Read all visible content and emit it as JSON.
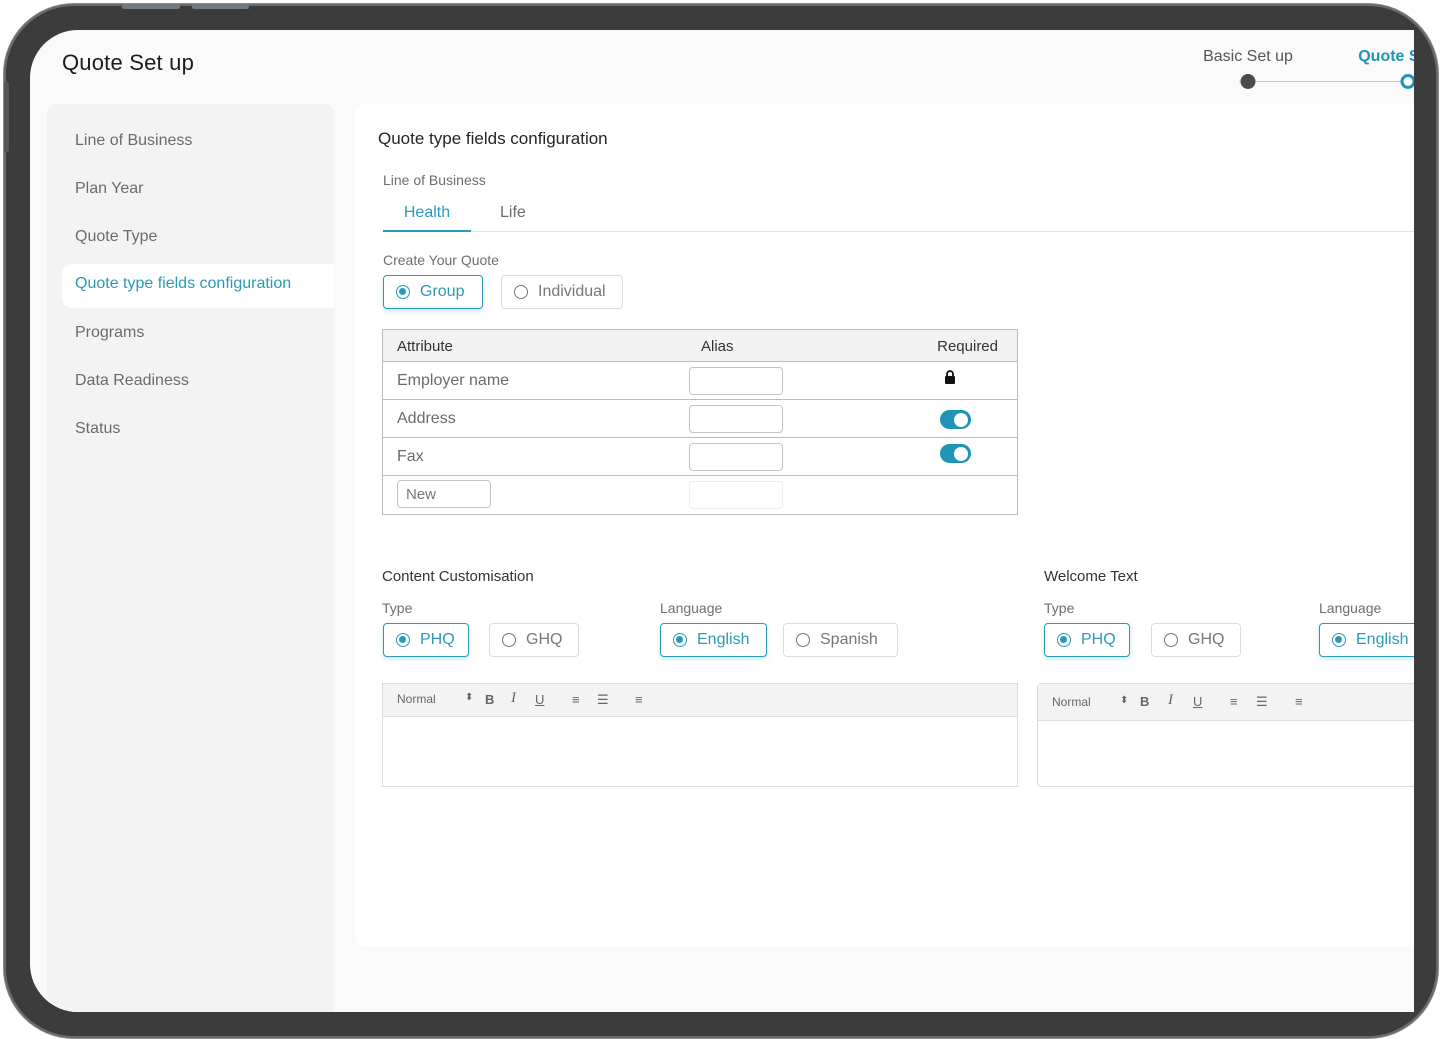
{
  "header": {
    "title": "Quote Set up"
  },
  "stepper": {
    "steps": [
      {
        "label": "Basic Set up",
        "state": "completed"
      },
      {
        "label": "Quote Set up",
        "state": "active"
      }
    ]
  },
  "sidebar": {
    "items": [
      {
        "label": "Line of Business",
        "active": false
      },
      {
        "label": "Plan Year",
        "active": false
      },
      {
        "label": "Quote Type",
        "active": false
      },
      {
        "label": "Quote type fields configuration",
        "active": true
      },
      {
        "label": "Programs",
        "active": false
      },
      {
        "label": "Data Readiness",
        "active": false
      },
      {
        "label": "Status",
        "active": false
      }
    ]
  },
  "main": {
    "title": "Quote type fields configuration",
    "line_of_business_label": "Line of Business",
    "tabs": [
      {
        "label": "Health",
        "active": true
      },
      {
        "label": "Life",
        "active": false
      }
    ],
    "create_quote_label": "Create Your Quote",
    "quote_options": [
      {
        "label": "Group",
        "selected": true
      },
      {
        "label": "Individual",
        "selected": false
      }
    ],
    "table": {
      "headers": {
        "attribute": "Attribute",
        "alias": "Alias",
        "required": "Required"
      },
      "rows": [
        {
          "attribute": "Employer name",
          "alias": "",
          "required": "locked"
        },
        {
          "attribute": "Address",
          "alias": "",
          "required": "on"
        },
        {
          "attribute": "Fax",
          "alias": "",
          "required": "on"
        }
      ],
      "new_row": {
        "attribute_value": "New",
        "alias": ""
      }
    },
    "content_customisation": {
      "title": "Content Customisation",
      "type_label": "Type",
      "type_options": [
        {
          "label": "PHQ",
          "selected": true
        },
        {
          "label": "GHQ",
          "selected": false
        }
      ],
      "language_label": "Language",
      "language_options": [
        {
          "label": "English",
          "selected": true
        },
        {
          "label": "Spanish",
          "selected": false
        }
      ],
      "editor": {
        "format": "Normal",
        "bold": "B",
        "italic": "I",
        "underline": "U",
        "ordered_list": "≡",
        "bullet_list": "☰",
        "align": "≡",
        "content": ""
      }
    },
    "welcome_text": {
      "title": "Welcome Text",
      "type_label": "Type",
      "type_options": [
        {
          "label": "PHQ",
          "selected": true
        },
        {
          "label": "GHQ",
          "selected": false
        }
      ],
      "language_label": "Language",
      "language_options": [
        {
          "label": "English",
          "selected": true
        }
      ],
      "editor": {
        "format": "Normal",
        "bold": "B",
        "italic": "I",
        "underline": "U",
        "ordered_list": "≡",
        "bullet_list": "☰",
        "align": "≡",
        "content": ""
      }
    }
  },
  "colors": {
    "accent": "#2b9ab8",
    "toggle_on": "#1e94b6",
    "bezel": "#3c3c3c",
    "sidebar_bg": "#f3f3f3"
  }
}
